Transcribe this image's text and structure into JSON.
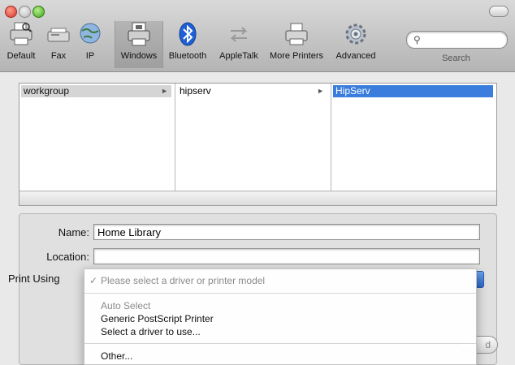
{
  "window": {
    "traffic_lights": [
      "close",
      "minimize",
      "zoom"
    ]
  },
  "toolbar": {
    "buttons": [
      {
        "label": "Default",
        "icon": "default-printer-icon"
      },
      {
        "label": "Fax",
        "icon": "fax-icon"
      },
      {
        "label": "IP",
        "icon": "ip-globe-icon"
      },
      {
        "label": "Windows",
        "icon": "windows-printer-icon",
        "active": true
      },
      {
        "label": "Bluetooth",
        "icon": "bluetooth-icon"
      },
      {
        "label": "AppleTalk",
        "icon": "appletalk-arrows-icon"
      },
      {
        "label": "More Printers",
        "icon": "more-printers-icon"
      },
      {
        "label": "Advanced",
        "icon": "gear-icon"
      }
    ],
    "search": {
      "label": "Search",
      "value": ""
    }
  },
  "browser": {
    "columns": [
      {
        "item": "workgroup",
        "selected": "gray",
        "has_children": true
      },
      {
        "item": "hipserv",
        "selected": "none",
        "has_children": true
      },
      {
        "item": "HipServ",
        "selected": "blue",
        "has_children": false
      }
    ]
  },
  "form": {
    "name_label": "Name:",
    "name_value": "Home Library",
    "location_label": "Location:",
    "location_value": "",
    "print_using_label": "Print Using"
  },
  "menu": {
    "items": [
      {
        "label": "Please select a driver or printer model",
        "checked": true,
        "disabled": true
      },
      {
        "label": "Auto Select",
        "checked": false,
        "disabled": true
      },
      {
        "label": "Generic PostScript Printer",
        "checked": false,
        "disabled": false
      },
      {
        "label": "Select a driver to use...",
        "checked": false,
        "disabled": false
      },
      {
        "label": "Other...",
        "checked": false,
        "disabled": false
      }
    ],
    "check_mark": "✓"
  },
  "add_button": {
    "label": "d"
  },
  "colors": {
    "selection_blue": "#3a7ddc",
    "bluetooth": "#1f5fd6"
  }
}
